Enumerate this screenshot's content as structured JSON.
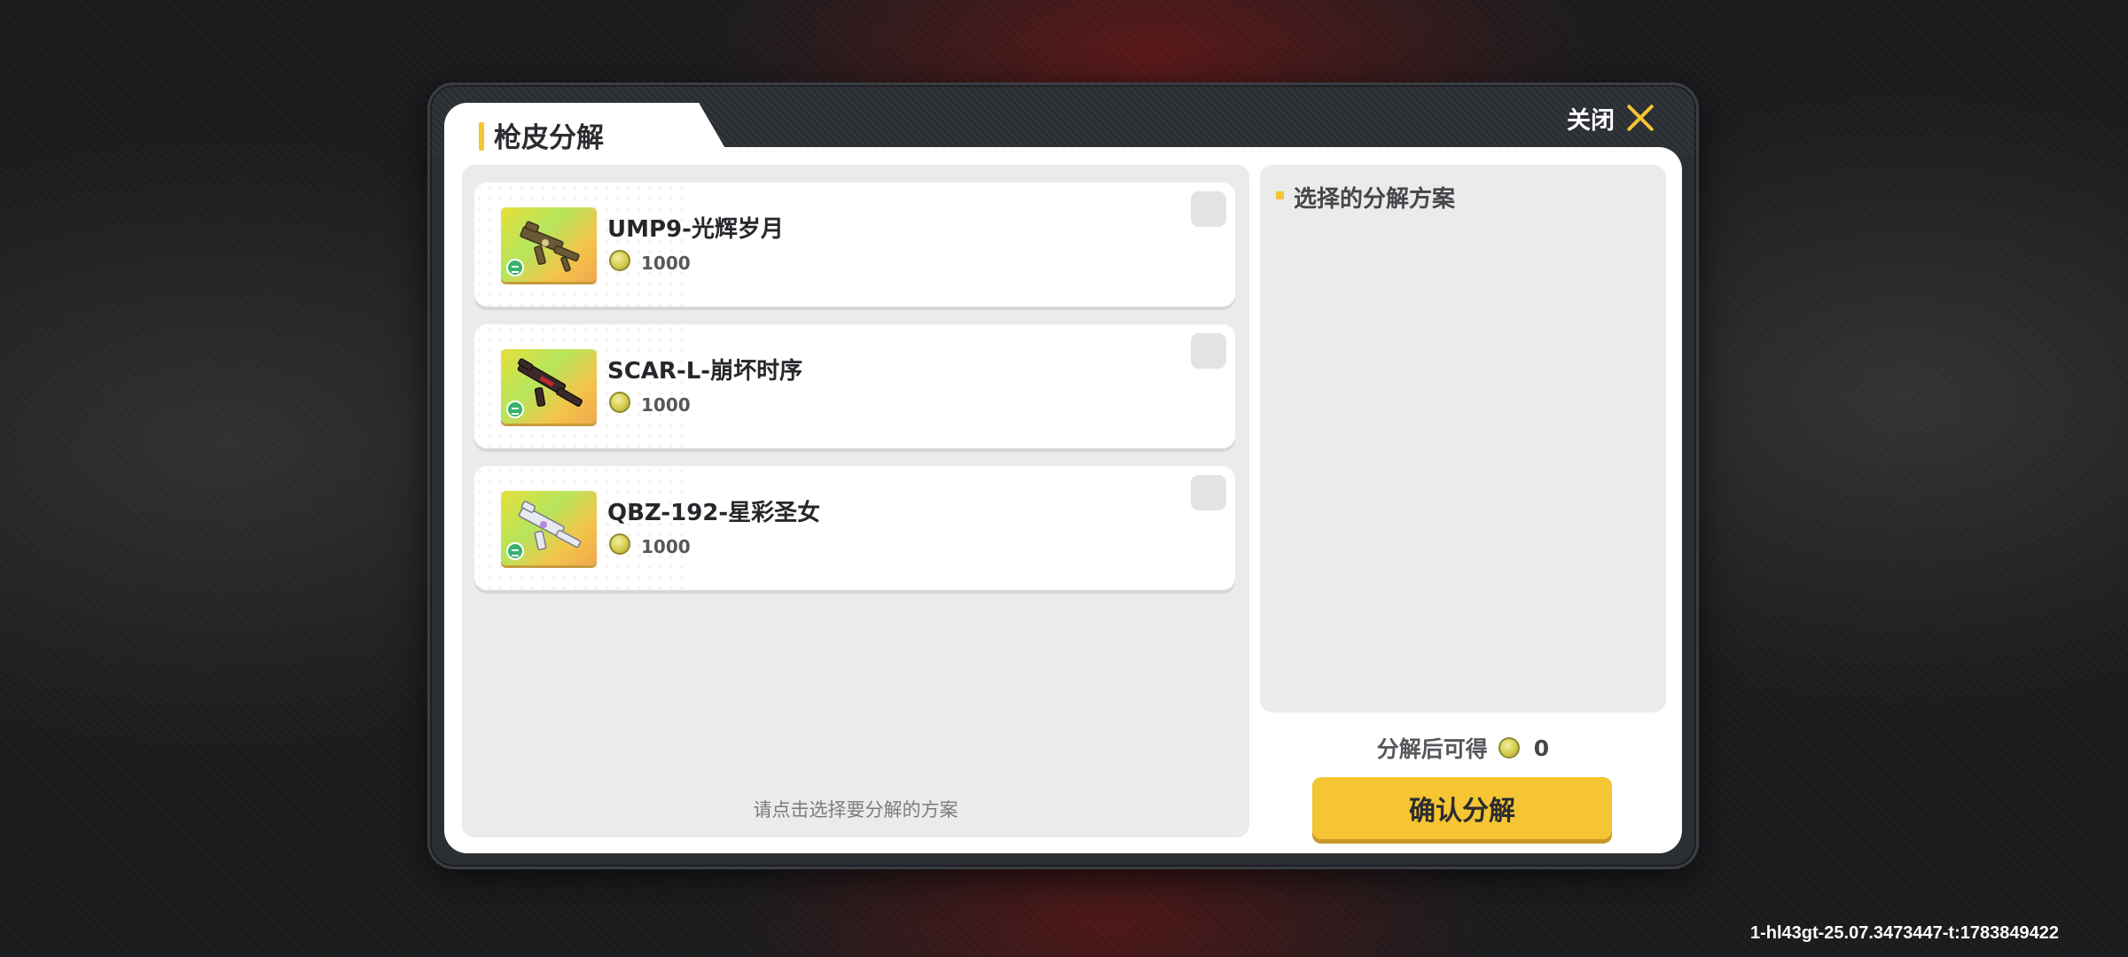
{
  "dialog": {
    "title": "枪皮分解",
    "close_label": "关闭"
  },
  "skins": [
    {
      "name": "UMP9-光辉岁月",
      "price": "1000",
      "checked": false
    },
    {
      "name": "SCAR-L-崩坏时序",
      "price": "1000",
      "checked": false
    },
    {
      "name": "QBZ-192-星彩圣女",
      "price": "1000",
      "checked": false
    }
  ],
  "list_hint": "请点击选择要分解的方案",
  "scheme": {
    "title": "选择的分解方案"
  },
  "yield": {
    "label": "分解后可得",
    "value": "0"
  },
  "confirm_label": "确认分解",
  "build_id": "1-hl43gt-25.07.3473447-t:1783849422",
  "colors": {
    "accent": "#f5c534",
    "panel_bg": "#ebebeb",
    "dialog_frame": "#2b2e33"
  }
}
